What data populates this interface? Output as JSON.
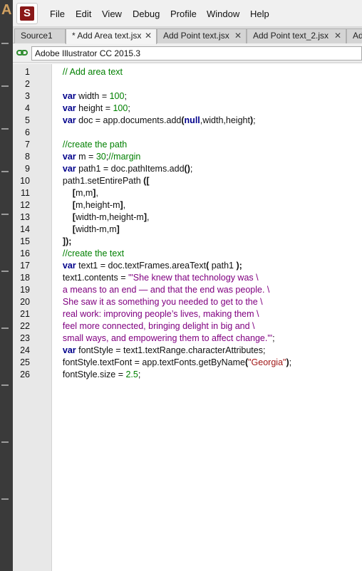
{
  "menu": {
    "items": [
      "File",
      "Edit",
      "View",
      "Debug",
      "Profile",
      "Window",
      "Help"
    ]
  },
  "tabs": [
    {
      "label": "Source1",
      "active": false
    },
    {
      "label": "* Add Area text.jsx",
      "active": true
    },
    {
      "label": "Add Point text.jsx",
      "active": false
    },
    {
      "label": "Add Point text_2.jsx",
      "active": false
    },
    {
      "label": "Ad",
      "active": false
    }
  ],
  "target": {
    "value": "Adobe Illustrator CC 2015.3"
  },
  "code_lines": [
    {
      "n": "1",
      "tokens": [
        [
          "    ",
          ""
        ],
        [
          "// Add area text",
          "cm"
        ]
      ]
    },
    {
      "n": "2",
      "tokens": []
    },
    {
      "n": "3",
      "tokens": [
        [
          "    ",
          ""
        ],
        [
          "var",
          "kw"
        ],
        [
          " width = ",
          ""
        ],
        [
          "100",
          "nm"
        ],
        [
          ";",
          ""
        ]
      ]
    },
    {
      "n": "4",
      "tokens": [
        [
          "    ",
          ""
        ],
        [
          "var",
          "kw"
        ],
        [
          " height = ",
          ""
        ],
        [
          "100",
          "nm"
        ],
        [
          ";",
          ""
        ]
      ]
    },
    {
      "n": "5",
      "tokens": [
        [
          "    ",
          ""
        ],
        [
          "var",
          "kw"
        ],
        [
          " doc = app.documents.add",
          ""
        ],
        [
          "(",
          "op"
        ],
        [
          "null",
          "kw"
        ],
        [
          ",width,height",
          ""
        ],
        [
          ")",
          "op"
        ],
        [
          ";",
          ""
        ]
      ]
    },
    {
      "n": "6",
      "tokens": []
    },
    {
      "n": "7",
      "tokens": [
        [
          "    ",
          ""
        ],
        [
          "//create the path",
          "cm"
        ]
      ]
    },
    {
      "n": "8",
      "tokens": [
        [
          "    ",
          ""
        ],
        [
          "var",
          "kw"
        ],
        [
          " m = ",
          ""
        ],
        [
          "30",
          "nm"
        ],
        [
          ";",
          ""
        ],
        [
          "//margin",
          "cm"
        ]
      ]
    },
    {
      "n": "9",
      "tokens": [
        [
          "    ",
          ""
        ],
        [
          "var",
          "kw"
        ],
        [
          " path1 = doc.pathItems.add",
          ""
        ],
        [
          "()",
          "op"
        ],
        [
          ";",
          ""
        ]
      ]
    },
    {
      "n": "10",
      "tokens": [
        [
          "    path1.setEntirePath ",
          ""
        ],
        [
          "([",
          "op"
        ]
      ]
    },
    {
      "n": "11",
      "tokens": [
        [
          "        ",
          ""
        ],
        [
          "[",
          "op"
        ],
        [
          "m,m",
          ""
        ],
        [
          "]",
          "op"
        ],
        [
          ",",
          ""
        ]
      ]
    },
    {
      "n": "12",
      "tokens": [
        [
          "        ",
          ""
        ],
        [
          "[",
          "op"
        ],
        [
          "m,height-m",
          ""
        ],
        [
          "]",
          "op"
        ],
        [
          ",",
          ""
        ]
      ]
    },
    {
      "n": "13",
      "tokens": [
        [
          "        ",
          ""
        ],
        [
          "[",
          "op"
        ],
        [
          "width-m,height-m",
          ""
        ],
        [
          "]",
          "op"
        ],
        [
          ",",
          ""
        ]
      ]
    },
    {
      "n": "14",
      "tokens": [
        [
          "        ",
          ""
        ],
        [
          "[",
          "op"
        ],
        [
          "width-m,m",
          ""
        ],
        [
          "]",
          "op"
        ]
      ]
    },
    {
      "n": "15",
      "tokens": [
        [
          "    ",
          ""
        ],
        [
          "]);",
          "op"
        ]
      ]
    },
    {
      "n": "16",
      "tokens": [
        [
          "    ",
          ""
        ],
        [
          "//create the text",
          "cm"
        ]
      ]
    },
    {
      "n": "17",
      "tokens": [
        [
          "    ",
          ""
        ],
        [
          "var",
          "kw"
        ],
        [
          " text1 = doc.textFrames.areaText",
          ""
        ],
        [
          "(",
          "op"
        ],
        [
          " path1 ",
          ""
        ],
        [
          ");",
          "op"
        ]
      ]
    },
    {
      "n": "18",
      "tokens": [
        [
          "    text1.contents = ",
          ""
        ],
        [
          "'\"She knew that technology was \\",
          "st"
        ]
      ]
    },
    {
      "n": "19",
      "tokens": [
        [
          "    ",
          ""
        ],
        [
          "a means to an end — and that the end was people. \\",
          "st"
        ]
      ]
    },
    {
      "n": "20",
      "tokens": [
        [
          "    ",
          ""
        ],
        [
          "She saw it as something you needed to get to the \\",
          "st"
        ]
      ]
    },
    {
      "n": "21",
      "tokens": [
        [
          "    ",
          ""
        ],
        [
          "real work: improving people’s lives, making them \\",
          "st"
        ]
      ]
    },
    {
      "n": "22",
      "tokens": [
        [
          "    ",
          ""
        ],
        [
          "feel more connected, bringing delight in big and \\",
          "st"
        ]
      ]
    },
    {
      "n": "23",
      "tokens": [
        [
          "    ",
          ""
        ],
        [
          "small ways, and empowering them to affect change.\"'",
          "st"
        ],
        [
          ";",
          ""
        ]
      ]
    },
    {
      "n": "24",
      "tokens": [
        [
          "    ",
          ""
        ],
        [
          "var",
          "kw"
        ],
        [
          " fontStyle = text1.textRange.characterAttributes;",
          ""
        ]
      ]
    },
    {
      "n": "25",
      "tokens": [
        [
          "    fontStyle.textFont = app.textFonts.getByName",
          ""
        ],
        [
          "(",
          "op"
        ],
        [
          "\"Georgia\"",
          "rs"
        ],
        [
          ")",
          "op"
        ],
        [
          ";",
          ""
        ]
      ]
    },
    {
      "n": "26",
      "tokens": [
        [
          "    fontStyle.size = ",
          ""
        ],
        [
          "2.5",
          "nm"
        ],
        [
          ";",
          ""
        ]
      ]
    }
  ]
}
